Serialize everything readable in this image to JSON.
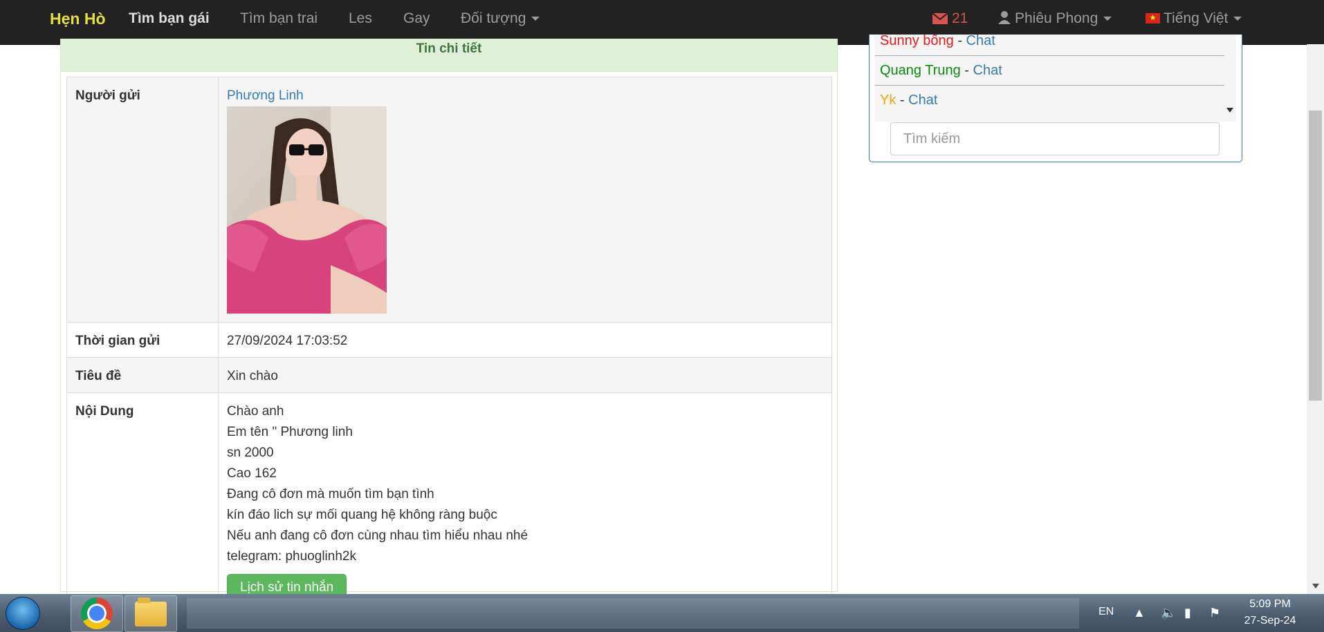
{
  "navbar": {
    "brand": "Hẹn Hò",
    "links": [
      {
        "label": "Tìm bạn gái",
        "active": true
      },
      {
        "label": "Tìm bạn trai",
        "active": false
      },
      {
        "label": "Les",
        "active": false
      },
      {
        "label": "Gay",
        "active": false
      }
    ],
    "dropdown_label": "Đối tượng",
    "mail_count": "21",
    "user_name": "Phiêu Phong",
    "language": "Tiếng Việt",
    "colors": {
      "background": "#222222",
      "brand": "#e4e03b",
      "mail": "#d9534f"
    }
  },
  "message_panel": {
    "heading": "Tin chi tiết",
    "rows": {
      "sender": {
        "label": "Người gửi",
        "name": "Phương Linh"
      },
      "sent_time": {
        "label": "Thời gian gửi",
        "value": "27/09/2024 17:03:52"
      },
      "subject": {
        "label": "Tiêu đề",
        "value": "Xin chào"
      },
      "content": {
        "label": "Nội Dung",
        "lines": [
          "Chào anh",
          "Em tên \" Phương linh",
          "sn 2000",
          "Cao 162",
          "Đang cô đơn mà muốn tìm bạn tình",
          "kín đáo lich sự mối quang hệ không ràng buộc",
          "Nếu anh đang cô đơn cùng nhau tìm hiểu nhau nhé",
          "telegram: phuoglinh2k"
        ]
      }
    },
    "history_button": "Lịch sử tin nhắn",
    "colors": {
      "heading_bg": "#dff0d8",
      "heading_text": "#3c763d",
      "button": "#5cb85c"
    }
  },
  "chat_panel": {
    "users": [
      {
        "name": "Sunny bống",
        "color": "#e01b1b",
        "separator": " - ",
        "action": "Chat"
      },
      {
        "name": "Quang Trung",
        "color": "#0b8a0b",
        "separator": " - ",
        "action": "Chat"
      },
      {
        "name": "Yk",
        "color": "#f0a30a",
        "separator": " - ",
        "action": "Chat"
      }
    ],
    "search_placeholder": "Tìm kiếm"
  },
  "taskbar": {
    "language": "EN",
    "time": "5:09 PM",
    "date": "27-Sep-24"
  }
}
